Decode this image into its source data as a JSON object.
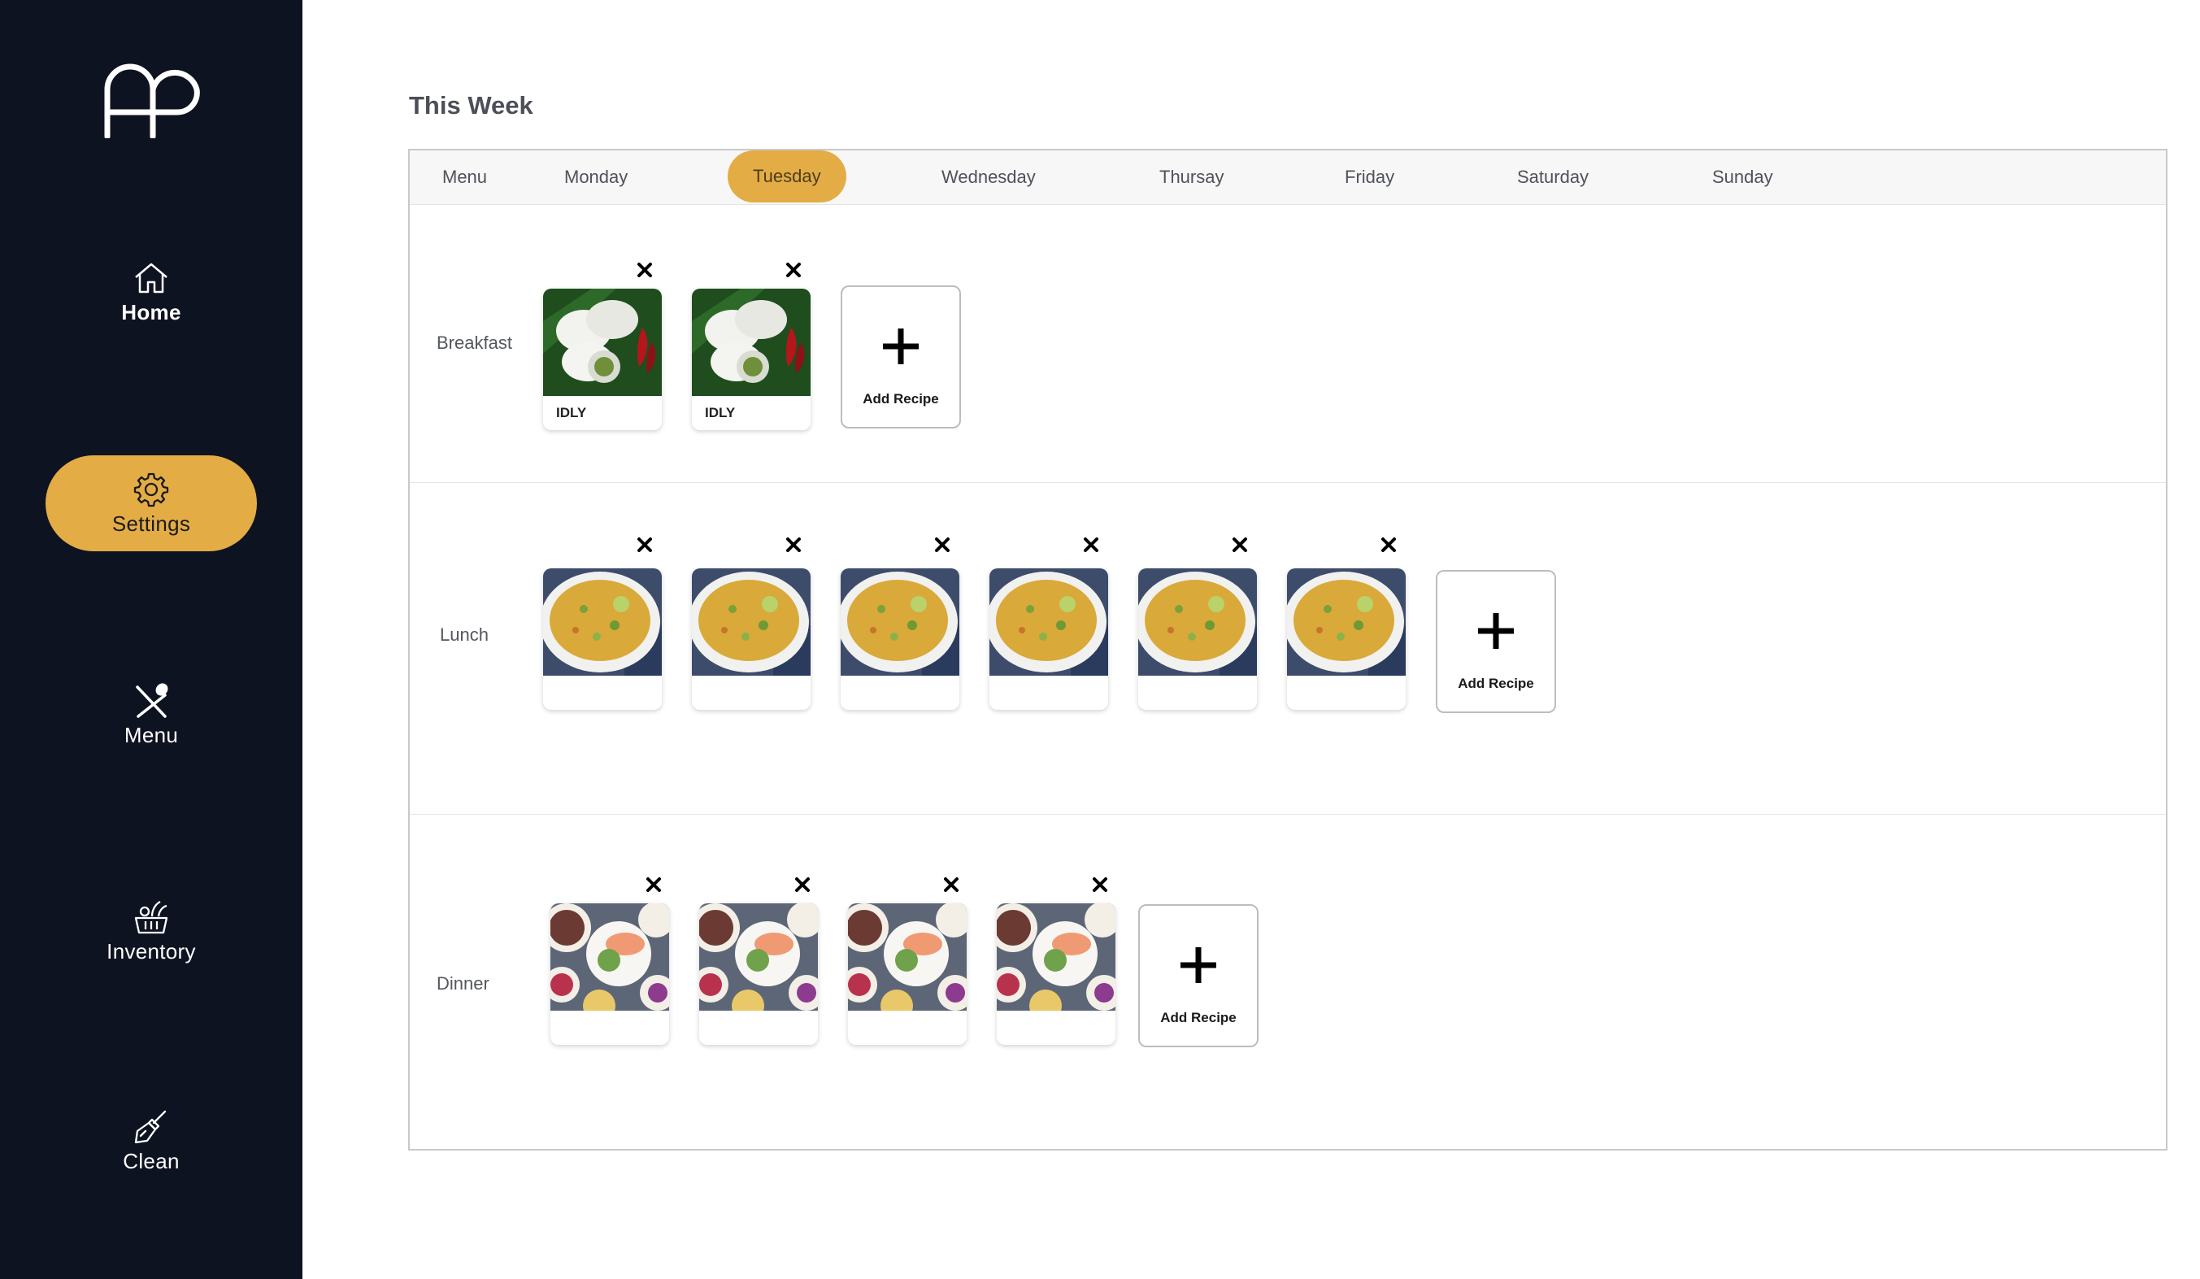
{
  "sidebar": {
    "logo_icon": "ap-monogram-logo",
    "items": [
      {
        "label": "Home",
        "icon": "home-icon",
        "active": false
      },
      {
        "label": "Settings",
        "icon": "gear-icon",
        "active": true
      },
      {
        "label": "Menu",
        "icon": "fork-spoon-icon",
        "active": false
      },
      {
        "label": "Inventory",
        "icon": "basket-icon",
        "active": false
      },
      {
        "label": "Clean",
        "icon": "broom-icon",
        "active": false
      }
    ]
  },
  "main": {
    "title": "This Week",
    "tabs": [
      {
        "label": "Menu",
        "active": false
      },
      {
        "label": "Monday",
        "active": false
      },
      {
        "label": "Tuesday",
        "active": true
      },
      {
        "label": "Wednesday",
        "active": false
      },
      {
        "label": "Thursay",
        "active": false
      },
      {
        "label": "Friday",
        "active": false
      },
      {
        "label": "Saturday",
        "active": false
      },
      {
        "label": "Sunday",
        "active": false
      }
    ],
    "meals": [
      {
        "label": "Breakfast",
        "recipes": [
          {
            "name": "IDLY",
            "image": "idly-photo"
          },
          {
            "name": "IDLY",
            "image": "idly-photo"
          }
        ]
      },
      {
        "label": "Lunch",
        "recipes": [
          {
            "name": "",
            "image": "rice-photo"
          },
          {
            "name": "",
            "image": "rice-photo"
          },
          {
            "name": "",
            "image": "rice-photo"
          },
          {
            "name": "",
            "image": "rice-photo"
          },
          {
            "name": "",
            "image": "rice-photo"
          },
          {
            "name": "",
            "image": "rice-photo"
          }
        ]
      },
      {
        "label": "Dinner",
        "recipes": [
          {
            "name": "",
            "image": "dinner-spread-photo"
          },
          {
            "name": "",
            "image": "dinner-spread-photo"
          },
          {
            "name": "",
            "image": "dinner-spread-photo"
          },
          {
            "name": "",
            "image": "dinner-spread-photo"
          }
        ]
      }
    ],
    "add_recipe_label": "Add Recipe"
  },
  "colors": {
    "sidebar_bg": "#0e1321",
    "accent": "#e3ac45"
  }
}
